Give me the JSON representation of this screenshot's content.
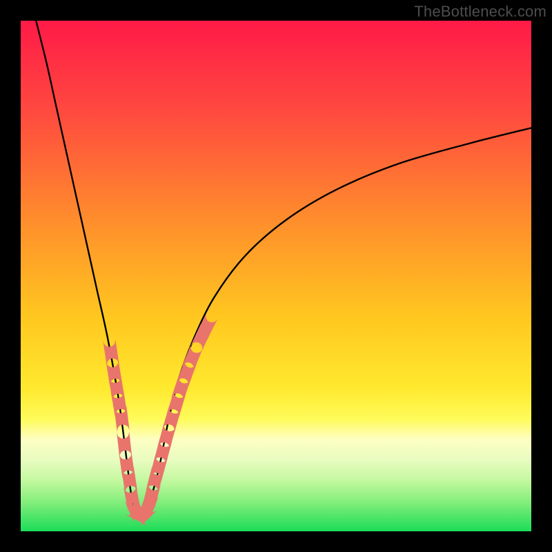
{
  "watermark": "TheBottleneck.com",
  "colors": {
    "frame": "#000000",
    "curve": "#000000",
    "marker_fill": "#e8746c",
    "marker_stroke": "#e8746c",
    "gradient_stops": [
      {
        "offset": "0%",
        "color": "#ff1a47"
      },
      {
        "offset": "18%",
        "color": "#ff4a3f"
      },
      {
        "offset": "38%",
        "color": "#ff8a2d"
      },
      {
        "offset": "58%",
        "color": "#ffc71f"
      },
      {
        "offset": "72%",
        "color": "#ffe92e"
      },
      {
        "offset": "78%",
        "color": "#fffb5a"
      },
      {
        "offset": "82%",
        "color": "#fdfec2"
      },
      {
        "offset": "86%",
        "color": "#e9fcc0"
      },
      {
        "offset": "90%",
        "color": "#c4f8a0"
      },
      {
        "offset": "94%",
        "color": "#88ef7d"
      },
      {
        "offset": "100%",
        "color": "#1bdc58"
      }
    ]
  },
  "chart_data": {
    "type": "line",
    "title": "",
    "xlabel": "",
    "ylabel": "",
    "xlim": [
      0,
      100
    ],
    "ylim": [
      0,
      100
    ],
    "series": [
      {
        "name": "bottleneck-curve",
        "x": [
          3,
          5,
          7,
          9,
          11,
          13,
          15,
          17,
          19,
          20,
          21,
          22,
          23,
          24,
          25,
          27,
          29,
          31,
          34,
          38,
          44,
          52,
          62,
          74,
          88,
          100
        ],
        "y": [
          100,
          92,
          83,
          74,
          65,
          56,
          47,
          38,
          27,
          20,
          12,
          5,
          3,
          3,
          5,
          12,
          22,
          30,
          38,
          46,
          54,
          61,
          67,
          72,
          76,
          79
        ]
      }
    ],
    "markers": [
      {
        "x": 17.7,
        "y": 35.0
      },
      {
        "x": 18.3,
        "y": 31.0
      },
      {
        "x": 18.8,
        "y": 28.0
      },
      {
        "x": 19.3,
        "y": 25.0
      },
      {
        "x": 19.8,
        "y": 22.0
      },
      {
        "x": 20.3,
        "y": 17.0
      },
      {
        "x": 20.8,
        "y": 13.0
      },
      {
        "x": 21.3,
        "y": 10.0
      },
      {
        "x": 21.8,
        "y": 6.5
      },
      {
        "x": 22.4,
        "y": 4.3
      },
      {
        "x": 23.2,
        "y": 3.3
      },
      {
        "x": 24.2,
        "y": 3.4
      },
      {
        "x": 25.0,
        "y": 5.0
      },
      {
        "x": 25.6,
        "y": 7.0
      },
      {
        "x": 26.3,
        "y": 10.0
      },
      {
        "x": 27.0,
        "y": 12.5
      },
      {
        "x": 27.8,
        "y": 15.5
      },
      {
        "x": 28.6,
        "y": 18.5
      },
      {
        "x": 29.6,
        "y": 22.0
      },
      {
        "x": 30.5,
        "y": 25.0
      },
      {
        "x": 31.4,
        "y": 28.0
      },
      {
        "x": 32.5,
        "y": 31.0
      },
      {
        "x": 33.6,
        "y": 34.0
      },
      {
        "x": 35.4,
        "y": 38.0
      },
      {
        "x": 36.4,
        "y": 40.0
      }
    ],
    "marker_radius": 1.2
  }
}
